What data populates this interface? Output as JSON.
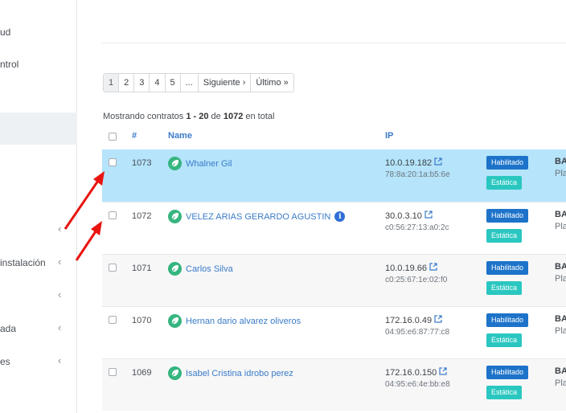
{
  "sidebar": {
    "items": [
      {
        "label": "ud",
        "chevron": false
      },
      {
        "label": "ntrol",
        "chevron": false
      },
      {
        "label": "",
        "chevron": true
      },
      {
        "label": "instalación",
        "chevron": true
      },
      {
        "label": "",
        "chevron": true
      },
      {
        "label": "ada",
        "chevron": true
      },
      {
        "label": "es",
        "chevron": true
      }
    ],
    "chevron_glyph": "‹"
  },
  "pagination": {
    "pages": [
      "1",
      "2",
      "3",
      "4",
      "5",
      "..."
    ],
    "active": "1",
    "next_label": "Siguiente ›",
    "last_label": "Último »"
  },
  "summary": {
    "prefix": "Mostrando contratos ",
    "range": "1 - 20",
    "middle": " de ",
    "total": "1072",
    "suffix": " en total"
  },
  "table": {
    "headers": {
      "number": "#",
      "name": "Name",
      "ip": "IP"
    },
    "rows": [
      {
        "number": "1073",
        "name": "Whalner Gil",
        "ip": "10.0.19.182",
        "mac": "78:8a:20:1a:b5:6e",
        "status": "Habilitado",
        "ip_type": "Estática",
        "col5_top": "BA",
        "col5_bottom": "Pla",
        "info": false,
        "selected": true
      },
      {
        "number": "1072",
        "name": "VELEZ ARIAS GERARDO AGUSTIN",
        "ip": "30.0.3.10",
        "mac": "c0:56:27:13:a0:2c",
        "status": "Habilitado",
        "ip_type": "Estática",
        "col5_top": "BA",
        "col5_bottom": "Pla",
        "info": true,
        "selected": false
      },
      {
        "number": "1071",
        "name": "Carlos Silva",
        "ip": "10.0.19.66",
        "mac": "c0:25:67:1e:02:f0",
        "status": "Habilitado",
        "ip_type": "Estática",
        "col5_top": "BA",
        "col5_bottom": "Pla",
        "info": false,
        "selected": false
      },
      {
        "number": "1070",
        "name": "Hernan dario alvarez oliveros",
        "ip": "172.16.0.49",
        "mac": "04:95:e6:87:77:c8",
        "status": "Habilitado",
        "ip_type": "Estática",
        "col5_top": "BA",
        "col5_bottom": "Pla",
        "info": false,
        "selected": false
      },
      {
        "number": "1069",
        "name": "Isabel Cristina idrobo perez",
        "ip": "172.16.0.150",
        "mac": "04:95:e6:4e:bb:e8",
        "status": "Habilitado",
        "ip_type": "Estática",
        "col5_top": "BA",
        "col5_bottom": "Pla",
        "info": false,
        "selected": false
      }
    ]
  },
  "icons": {
    "connection": "plug-leaf-icon",
    "external": "external-link-icon",
    "info": "info-icon"
  },
  "colors": {
    "selected_row": "#b5e4fb",
    "link": "#3a7bc8",
    "badge_enabled": "#1d73c9",
    "badge_static": "#2ac7c0",
    "connection_icon": "#35b57f",
    "annotation_arrow": "#e8140f"
  }
}
